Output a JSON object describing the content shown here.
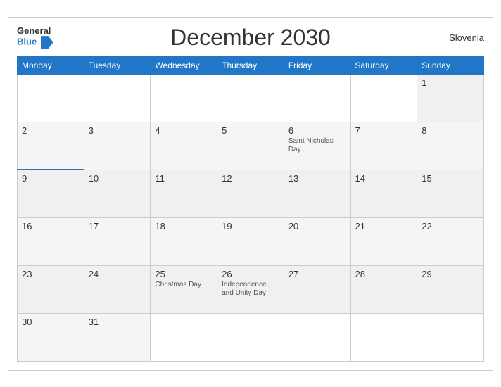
{
  "header": {
    "title": "December 2030",
    "country": "Slovenia",
    "logo_general": "General",
    "logo_blue": "Blue"
  },
  "weekdays": [
    "Monday",
    "Tuesday",
    "Wednesday",
    "Thursday",
    "Friday",
    "Saturday",
    "Sunday"
  ],
  "weeks": [
    [
      {
        "day": "",
        "empty": true
      },
      {
        "day": "",
        "empty": true
      },
      {
        "day": "",
        "empty": true
      },
      {
        "day": "",
        "empty": true
      },
      {
        "day": "",
        "empty": true
      },
      {
        "day": "",
        "empty": true
      },
      {
        "day": "1",
        "event": ""
      }
    ],
    [
      {
        "day": "2",
        "event": ""
      },
      {
        "day": "3",
        "event": ""
      },
      {
        "day": "4",
        "event": ""
      },
      {
        "day": "5",
        "event": ""
      },
      {
        "day": "6",
        "event": "Saint Nicholas Day"
      },
      {
        "day": "7",
        "event": ""
      },
      {
        "day": "8",
        "event": ""
      }
    ],
    [
      {
        "day": "9",
        "event": "",
        "topBlue": true
      },
      {
        "day": "10",
        "event": ""
      },
      {
        "day": "11",
        "event": ""
      },
      {
        "day": "12",
        "event": ""
      },
      {
        "day": "13",
        "event": ""
      },
      {
        "day": "14",
        "event": ""
      },
      {
        "day": "15",
        "event": ""
      }
    ],
    [
      {
        "day": "16",
        "event": ""
      },
      {
        "day": "17",
        "event": ""
      },
      {
        "day": "18",
        "event": ""
      },
      {
        "day": "19",
        "event": ""
      },
      {
        "day": "20",
        "event": ""
      },
      {
        "day": "21",
        "event": ""
      },
      {
        "day": "22",
        "event": ""
      }
    ],
    [
      {
        "day": "23",
        "event": ""
      },
      {
        "day": "24",
        "event": ""
      },
      {
        "day": "25",
        "event": "Christmas Day"
      },
      {
        "day": "26",
        "event": "Independence and Unity Day"
      },
      {
        "day": "27",
        "event": ""
      },
      {
        "day": "28",
        "event": ""
      },
      {
        "day": "29",
        "event": ""
      }
    ],
    [
      {
        "day": "30",
        "event": ""
      },
      {
        "day": "31",
        "event": ""
      },
      {
        "day": "",
        "empty": true
      },
      {
        "day": "",
        "empty": true
      },
      {
        "day": "",
        "empty": true
      },
      {
        "day": "",
        "empty": true
      },
      {
        "day": "",
        "empty": true
      }
    ]
  ]
}
